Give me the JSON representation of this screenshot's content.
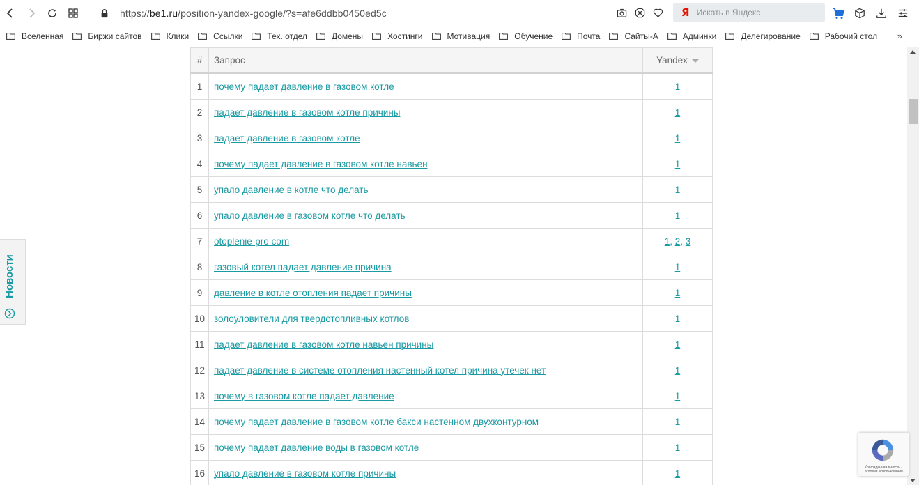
{
  "browser": {
    "url_scheme": "https://",
    "url_host": "be1.ru",
    "url_path": "/position-yandex-google/?s=afe6ddbb0450ed5c",
    "search_logo": "Я",
    "search_placeholder": "Искать в Яндекс"
  },
  "bookmarks": [
    {
      "label": "Вселенная"
    },
    {
      "label": "Биржи сайтов"
    },
    {
      "label": "Клики"
    },
    {
      "label": "Ссылки"
    },
    {
      "label": "Тех. отдел"
    },
    {
      "label": "Домены"
    },
    {
      "label": "Хостинги"
    },
    {
      "label": "Мотивация"
    },
    {
      "label": "Обучение"
    },
    {
      "label": "Почта"
    },
    {
      "label": "Сайты-А"
    },
    {
      "label": "Админки"
    },
    {
      "label": "Делегирование"
    },
    {
      "label": "Рабочий стол"
    }
  ],
  "bookmarks_more": "»",
  "table": {
    "headers": {
      "num": "#",
      "query": "Запрос",
      "engine": "Yandex"
    },
    "rows": [
      {
        "num": "1",
        "query": "почему падает давление в газовом котле",
        "positions": [
          "1"
        ]
      },
      {
        "num": "2",
        "query": "падает давление в газовом котле причины",
        "positions": [
          "1"
        ]
      },
      {
        "num": "3",
        "query": "падает давление в газовом котле",
        "positions": [
          "1"
        ]
      },
      {
        "num": "4",
        "query": "почему падает давление в газовом котле навьен",
        "positions": [
          "1"
        ]
      },
      {
        "num": "5",
        "query": "упало давление в котле что делать",
        "positions": [
          "1"
        ]
      },
      {
        "num": "6",
        "query": "упало давление в газовом котле что делать",
        "positions": [
          "1"
        ]
      },
      {
        "num": "7",
        "query": "otoplenie-pro com",
        "positions": [
          "1",
          "2",
          "3"
        ]
      },
      {
        "num": "8",
        "query": "газовый котел падает давление причина",
        "positions": [
          "1"
        ]
      },
      {
        "num": "9",
        "query": "давление в котле отопления падает причины",
        "positions": [
          "1"
        ]
      },
      {
        "num": "10",
        "query": "золоуловители для твердотопливных котлов",
        "positions": [
          "1"
        ]
      },
      {
        "num": "11",
        "query": "падает давление в газовом котле навьен причины",
        "positions": [
          "1"
        ]
      },
      {
        "num": "12",
        "query": "падает давление в системе отопления настенный котел причина утечек нет",
        "positions": [
          "1"
        ]
      },
      {
        "num": "13",
        "query": "почему в газовом котле падает давление",
        "positions": [
          "1"
        ]
      },
      {
        "num": "14",
        "query": "почему падает давление в газовом котле бакси настенном двухконтурном",
        "positions": [
          "1"
        ]
      },
      {
        "num": "15",
        "query": "почему падает давление воды в газовом котле",
        "positions": [
          "1"
        ]
      },
      {
        "num": "16",
        "query": "упало давление в газовом котле причины",
        "positions": [
          "1"
        ]
      }
    ]
  },
  "side_tab": {
    "label": "Новости"
  },
  "recaptcha": {
    "text": "Конфиденциальность - Условия использования"
  },
  "colors": {
    "link": "#1a9aa3",
    "yandex_red": "#e61400",
    "cart_blue": "#1e6fd9"
  }
}
